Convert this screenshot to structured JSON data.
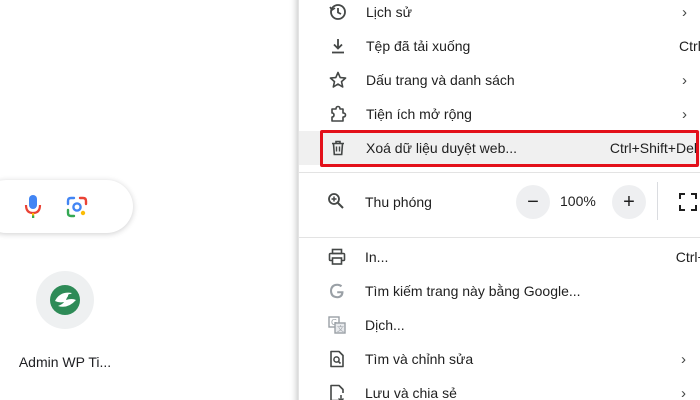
{
  "newtab": {
    "shortcut_label": "Admin WP Ti..."
  },
  "menu": {
    "history": {
      "label": "Lịch sử",
      "icon": "history-icon"
    },
    "downloads": {
      "label": "Tệp đã tải xuống",
      "shortcut": "Ctrl+J",
      "icon": "download-icon"
    },
    "bookmarks": {
      "label": "Dấu trang và danh sách",
      "icon": "star-icon"
    },
    "extensions": {
      "label": "Tiện ích mở rộng",
      "icon": "puzzle-icon"
    },
    "clear_data": {
      "label": "Xoá dữ liệu duyệt web...",
      "shortcut": "Ctrl+Shift+Del",
      "icon": "trash-icon"
    },
    "zoom": {
      "label": "Thu phóng",
      "value": "100%",
      "minus": "−",
      "plus": "+",
      "icon": "zoom-icon"
    },
    "print": {
      "label": "In...",
      "shortcut": "Ctrl+P",
      "icon": "print-icon"
    },
    "search_google": {
      "label": "Tìm kiếm trang này bằng Google...",
      "icon": "google-icon"
    },
    "translate": {
      "label": "Dịch...",
      "icon": "translate-icon"
    },
    "find_edit": {
      "label": "Tìm và chỉnh sửa",
      "icon": "find-page-icon"
    },
    "save_share": {
      "label": "Lưu và chia sẻ",
      "icon": "save-share-icon"
    }
  },
  "colors": {
    "highlight_border": "#e3101a",
    "hover_bg": "#f0f0f0",
    "google_blue": "#4285f4"
  }
}
